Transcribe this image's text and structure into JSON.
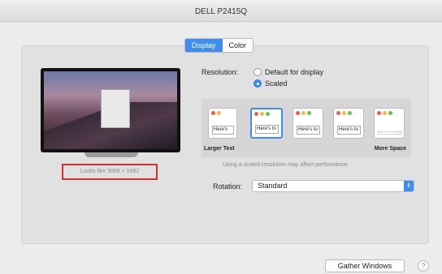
{
  "window": {
    "title": "DELL P2415Q"
  },
  "tabs": [
    {
      "label": "Display",
      "active": true
    },
    {
      "label": "Color",
      "active": false
    }
  ],
  "display": {
    "looks_like": "Looks like 3008 × 1692",
    "resolution_label": "Resolution:",
    "resolution_options": [
      {
        "label": "Default for display",
        "selected": false
      },
      {
        "label": "Scaled",
        "selected": true
      }
    ],
    "scale_thumbnails": [
      {
        "text": "Here's"
      },
      {
        "text": "Here's to the crazy"
      },
      {
        "text": "Here's to the troublemakers"
      },
      {
        "text": "Here's to the crazy ones"
      },
      {
        "text": ""
      }
    ],
    "larger_text": "Larger Text",
    "more_space": "More Space",
    "hint": "Using a scaled resolution may affect performance.",
    "rotation_label": "Rotation:",
    "rotation_value": "Standard"
  },
  "footer": {
    "gather_windows": "Gather Windows",
    "help": "?"
  },
  "colors": {
    "accent": "#3d8ef2",
    "highlight_border": "#d9302c"
  }
}
